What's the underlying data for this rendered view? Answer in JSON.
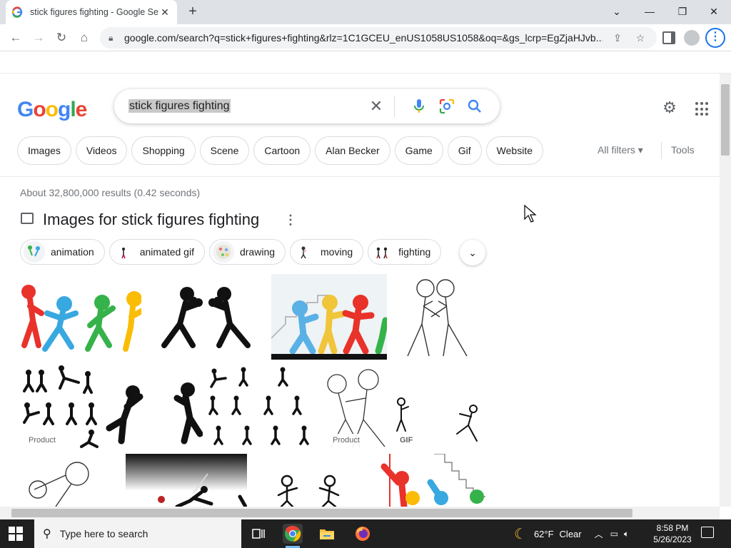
{
  "browser": {
    "tab_title": "stick figures fighting - Google Se",
    "tab_close": "✕",
    "new_tab": "+",
    "url": "google.com/search?q=stick+figures+fighting&rlz=1C1GCEU_enUS1058US1058&oq=&gs_lcrp=EgZjaHJvb...",
    "window_minimize": "—",
    "window_restore": "❐",
    "window_close": "✕",
    "tab_list": "⌄"
  },
  "google": {
    "logo_letters": [
      "G",
      "o",
      "o",
      "g",
      "l",
      "e"
    ],
    "logo_colors": [
      "#4285F4",
      "#EA4335",
      "#FBBC05",
      "#4285F4",
      "#34A853",
      "#EA4335"
    ],
    "query": "stick figures fighting",
    "clear": "✕",
    "filter_chips": [
      "Images",
      "Videos",
      "Shopping",
      "Scene",
      "Cartoon",
      "Alan Becker",
      "Game",
      "Gif",
      "Website"
    ],
    "all_filters": "All filters ▾",
    "tools": "Tools",
    "result_stats": "About 32,800,000 results (0.42 seconds)",
    "images_title": "Images for stick figures fighting",
    "related_chips": [
      "animation",
      "animated gif",
      "drawing",
      "moving",
      "fighting"
    ],
    "badges": {
      "product": "Product",
      "gif": "GIF"
    }
  },
  "taskbar": {
    "search_placeholder": "Type here to search",
    "weather_temp": "62°F",
    "weather_desc": "Clear",
    "time": "8:58 PM",
    "date": "5/26/2023"
  }
}
